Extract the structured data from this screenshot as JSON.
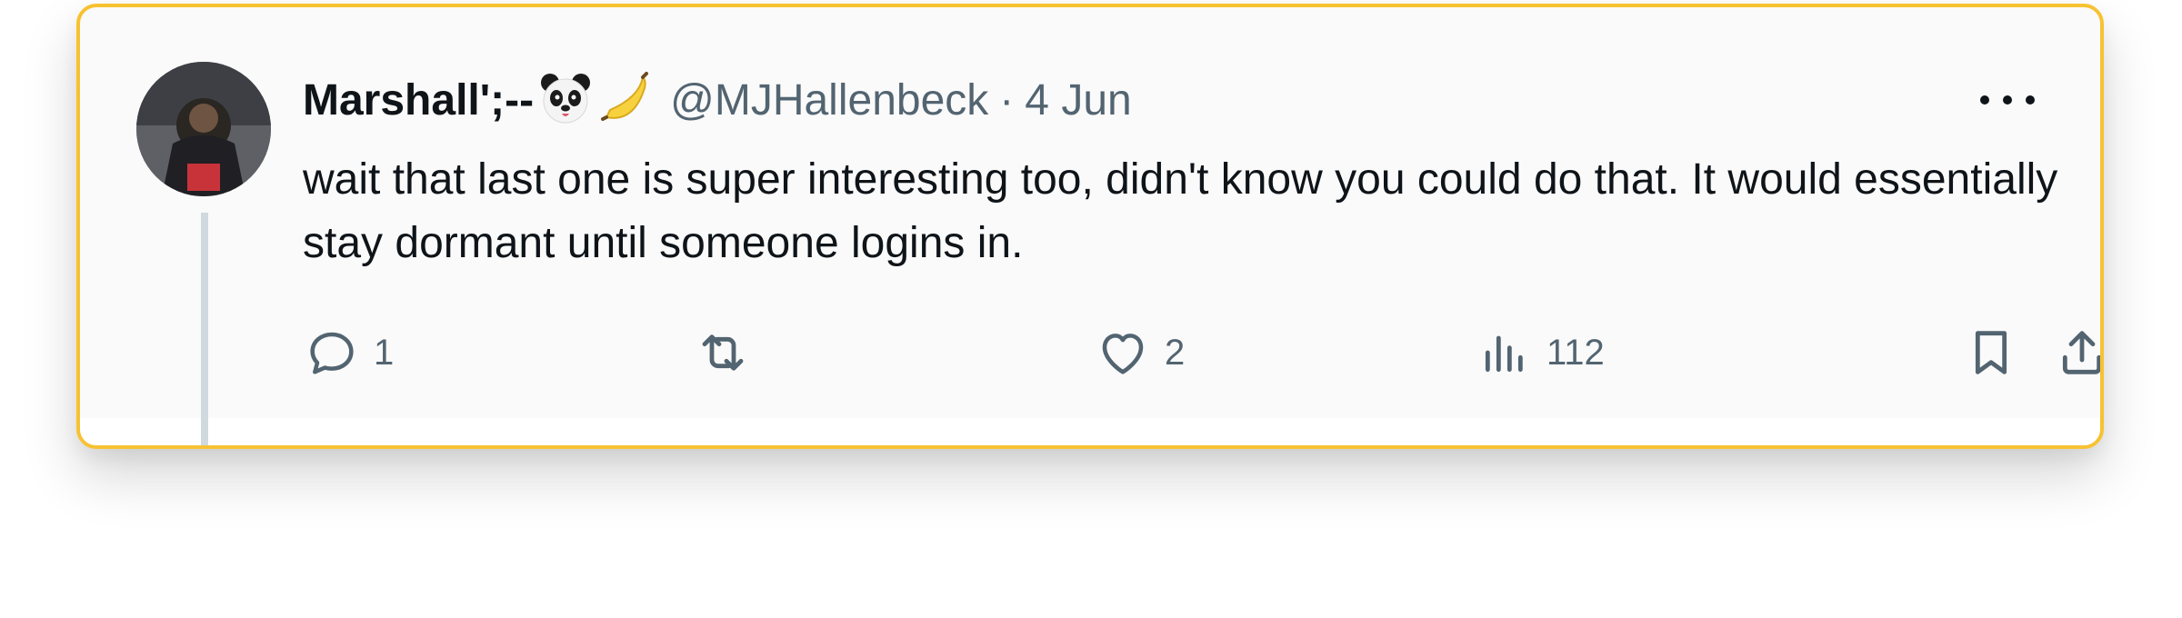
{
  "tweet": {
    "display_name": "Marshall';--",
    "handle": "@MJHallenbeck",
    "separator": "·",
    "date": "4 Jun",
    "text": "wait that last one is super interesting too, didn't know you could do that. It would essentially stay dormant until someone logins in.",
    "emojis": [
      "panda-icon",
      "banana-icon"
    ]
  },
  "actions": {
    "reply_count": "1",
    "retweet_count": "",
    "like_count": "2",
    "view_count": "112"
  },
  "colors": {
    "card_border": "#f7c232",
    "text_primary": "#0f1419",
    "text_secondary": "#536471",
    "thread_line": "#cfd9de"
  }
}
